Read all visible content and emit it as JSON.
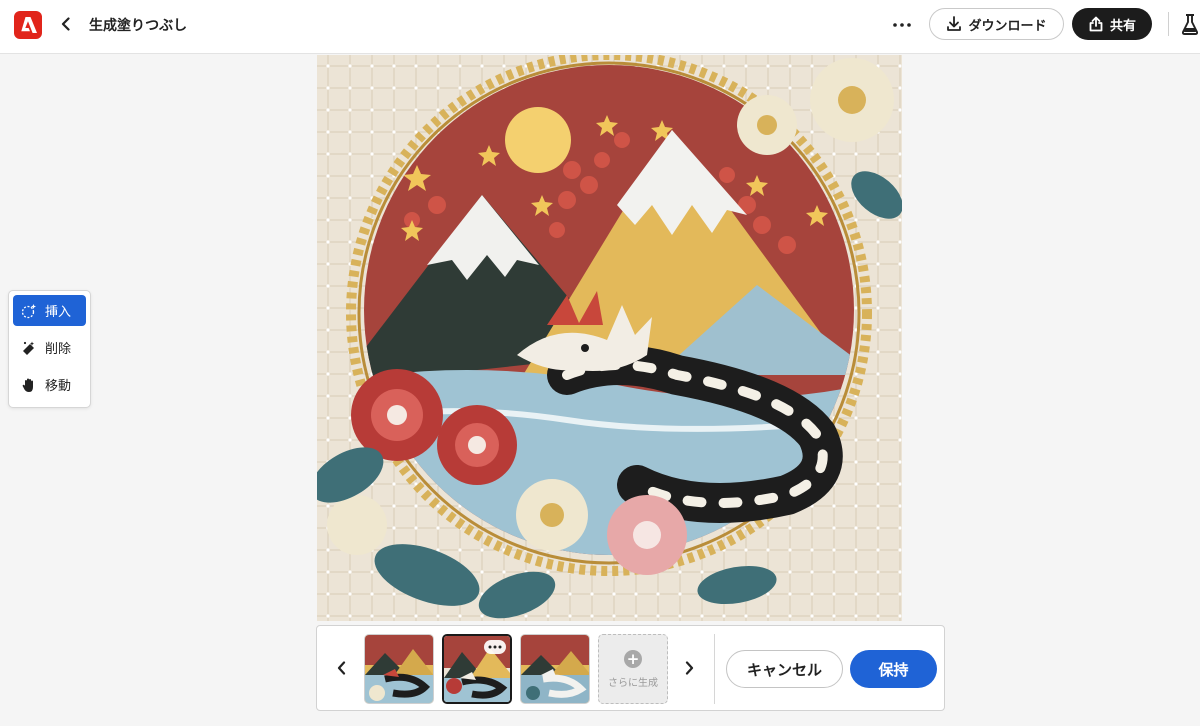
{
  "header": {
    "title": "生成塗りつぶし",
    "download_label": "ダウンロード",
    "share_label": "共有"
  },
  "icons": {
    "logo": "adobe-express-logo",
    "back": "chevron-left-icon",
    "more": "more-horizontal-icon",
    "download": "download-icon",
    "share": "share-icon",
    "labs": "flask-icon"
  },
  "tools": [
    {
      "label": "挿入",
      "icon": "insert-sparkle-icon",
      "active": true
    },
    {
      "label": "削除",
      "icon": "remove-eraser-icon",
      "active": false
    },
    {
      "label": "移動",
      "icon": "hand-icon",
      "active": false
    }
  ],
  "canvas": {
    "description": "generated artwork"
  },
  "variations": {
    "count": 3,
    "selected_index": 1,
    "generate_more_label": "さらに生成"
  },
  "actions": {
    "cancel_label": "キャンセル",
    "keep_label": "保持"
  },
  "colors": {
    "accent": "#1f63d6",
    "brand": "#e1251b",
    "dark_button": "#1c1c1c"
  }
}
